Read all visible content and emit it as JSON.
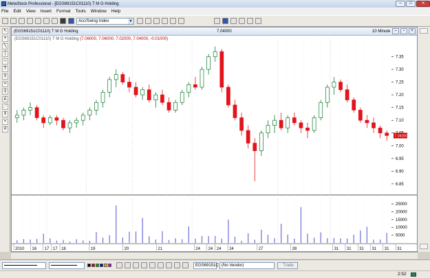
{
  "app": {
    "window_title": "MetaStock Professional - [EGS69151C01110) T M G Holding",
    "menu": [
      "File",
      "Edit",
      "View",
      "Insert",
      "Format",
      "Tools",
      "Window",
      "Help"
    ]
  },
  "toolbar": {
    "indicator_select": "Acc/Swing Index"
  },
  "chart_window": {
    "title": "(EGS69151C01110) T M G Holding",
    "center_value": "7.04000",
    "timeframe": "10 Minute",
    "security_label": "(EGS69151C01110) T M G Holding",
    "ohlc_label": "(7.06000, 7.06000, 7.02000, 7.04000, -0.01000)",
    "last_price_badge": "7.04000"
  },
  "chart_data": {
    "type": "candlestick",
    "price_axis": {
      "ticks": [
        "7.35",
        "7.30",
        "7.25",
        "7.20",
        "7.15",
        "7.10",
        "7.05",
        "7.00",
        "6.95",
        "6.90",
        "6.85"
      ],
      "range": [
        6.82,
        7.4
      ]
    },
    "volume_axis": {
      "ticks": [
        "25000",
        "20000",
        "15000",
        "10000",
        "5000"
      ],
      "range": [
        0,
        29000
      ]
    },
    "x_tick_labels": [
      "2010",
      "16",
      "17",
      "17",
      "18",
      "19",
      "20",
      "21",
      "24",
      "24",
      "24",
      "24",
      "27",
      "28",
      "31",
      "31",
      "31",
      "31",
      "31",
      "31"
    ],
    "x_tick_day_labels_strip": [
      "2010",
      "|16|",
      "|17|",
      "17|",
      "18|",
      "19",
      "20",
      "21",
      "24|",
      "24|",
      "24|",
      "24|",
      "27",
      "28",
      "31|",
      "31|",
      "31|",
      "31|",
      "31|",
      "31"
    ],
    "candles": [
      [
        7.11,
        7.14,
        7.09,
        7.12
      ],
      [
        7.12,
        7.15,
        7.1,
        7.14
      ],
      [
        7.14,
        7.17,
        7.12,
        7.15
      ],
      [
        7.15,
        7.16,
        7.1,
        7.11
      ],
      [
        7.11,
        7.12,
        7.07,
        7.09
      ],
      [
        7.09,
        7.12,
        7.08,
        7.11
      ],
      [
        7.11,
        7.12,
        7.08,
        7.1
      ],
      [
        7.1,
        7.11,
        7.06,
        7.07
      ],
      [
        7.07,
        7.1,
        7.05,
        7.09
      ],
      [
        7.09,
        7.11,
        7.07,
        7.1
      ],
      [
        7.1,
        7.13,
        7.08,
        7.12
      ],
      [
        7.12,
        7.15,
        7.1,
        7.14
      ],
      [
        7.14,
        7.18,
        7.12,
        7.17
      ],
      [
        7.17,
        7.22,
        7.15,
        7.21
      ],
      [
        7.21,
        7.27,
        7.19,
        7.26
      ],
      [
        7.26,
        7.3,
        7.23,
        7.28
      ],
      [
        7.28,
        7.29,
        7.24,
        7.25
      ],
      [
        7.25,
        7.27,
        7.21,
        7.23
      ],
      [
        7.23,
        7.25,
        7.19,
        7.2
      ],
      [
        7.2,
        7.23,
        7.18,
        7.22
      ],
      [
        7.22,
        7.24,
        7.17,
        7.18
      ],
      [
        7.18,
        7.21,
        7.15,
        7.2
      ],
      [
        7.2,
        7.22,
        7.16,
        7.17
      ],
      [
        7.17,
        7.19,
        7.13,
        7.14
      ],
      [
        7.14,
        7.18,
        7.13,
        7.17
      ],
      [
        7.17,
        7.22,
        7.16,
        7.21
      ],
      [
        7.21,
        7.25,
        7.19,
        7.24
      ],
      [
        7.24,
        7.27,
        7.22,
        7.23
      ],
      [
        7.23,
        7.31,
        7.22,
        7.3
      ],
      [
        7.3,
        7.36,
        7.28,
        7.35
      ],
      [
        7.35,
        7.39,
        7.33,
        7.37
      ],
      [
        7.37,
        7.38,
        7.21,
        7.23
      ],
      [
        7.23,
        7.24,
        7.15,
        7.16
      ],
      [
        7.16,
        7.18,
        7.1,
        7.11
      ],
      [
        7.11,
        7.13,
        7.04,
        7.06
      ],
      [
        7.06,
        7.08,
        6.99,
        7.01
      ],
      [
        7.01,
        7.03,
        6.86,
        6.98
      ],
      [
        6.98,
        7.06,
        6.96,
        7.05
      ],
      [
        7.05,
        7.1,
        7.03,
        7.08
      ],
      [
        7.08,
        7.12,
        7.05,
        7.1
      ],
      [
        7.1,
        7.13,
        7.06,
        7.07
      ],
      [
        7.07,
        7.12,
        7.05,
        7.11
      ],
      [
        7.11,
        7.13,
        7.08,
        7.09
      ],
      [
        7.09,
        7.1,
        7.05,
        7.07
      ],
      [
        7.07,
        7.09,
        7.03,
        7.06
      ],
      [
        7.06,
        7.12,
        7.05,
        7.11
      ],
      [
        7.11,
        7.18,
        7.1,
        7.17
      ],
      [
        7.17,
        7.24,
        7.15,
        7.23
      ],
      [
        7.23,
        7.27,
        7.2,
        7.25
      ],
      [
        7.25,
        7.26,
        7.21,
        7.22
      ],
      [
        7.22,
        7.24,
        7.17,
        7.18
      ],
      [
        7.18,
        7.19,
        7.13,
        7.14
      ],
      [
        7.14,
        7.15,
        7.09,
        7.1
      ],
      [
        7.1,
        7.12,
        7.07,
        7.09
      ],
      [
        7.09,
        7.11,
        7.05,
        7.07
      ],
      [
        7.07,
        7.08,
        7.03,
        7.05
      ],
      [
        7.05,
        7.06,
        7.02,
        7.04
      ]
    ],
    "volume": [
      1800,
      2500,
      2200,
      2600,
      6000,
      3000,
      1500,
      2000,
      900,
      2400,
      1700,
      1400,
      7000,
      3400,
      5000,
      24000,
      3500,
      7200,
      7400,
      16000,
      4300,
      2200,
      7600,
      1900,
      3000,
      2400,
      10600,
      2800,
      4500,
      4400,
      4500,
      2800,
      15000,
      4000,
      1400,
      6200,
      2100,
      8500,
      5300,
      3000,
      12300,
      5400,
      2800,
      23000,
      6000,
      3400,
      6800,
      3100,
      3200,
      3000,
      2800,
      5400,
      8000,
      10400,
      2100,
      2200,
      6500
    ],
    "grid": "dotted vertical day separators",
    "colors": {
      "up": "#0b7a2a",
      "down": "#e0141a",
      "volume": "#6b6bd6",
      "badge": "#d00000"
    }
  },
  "bottom": {
    "security_field": "EGS69151C",
    "vendor_field": "(No Vendor)",
    "trade_button": "Trade"
  },
  "status": {
    "time": "2:52"
  },
  "icons": [
    "metastock-app-icon",
    "minimize-icon",
    "maximize-icon",
    "close-icon",
    "new-chart-icon",
    "open-icon",
    "save-icon",
    "print-icon",
    "cursor-icon",
    "crosshair-icon",
    "trendline-icon",
    "color-swatch-icon"
  ]
}
